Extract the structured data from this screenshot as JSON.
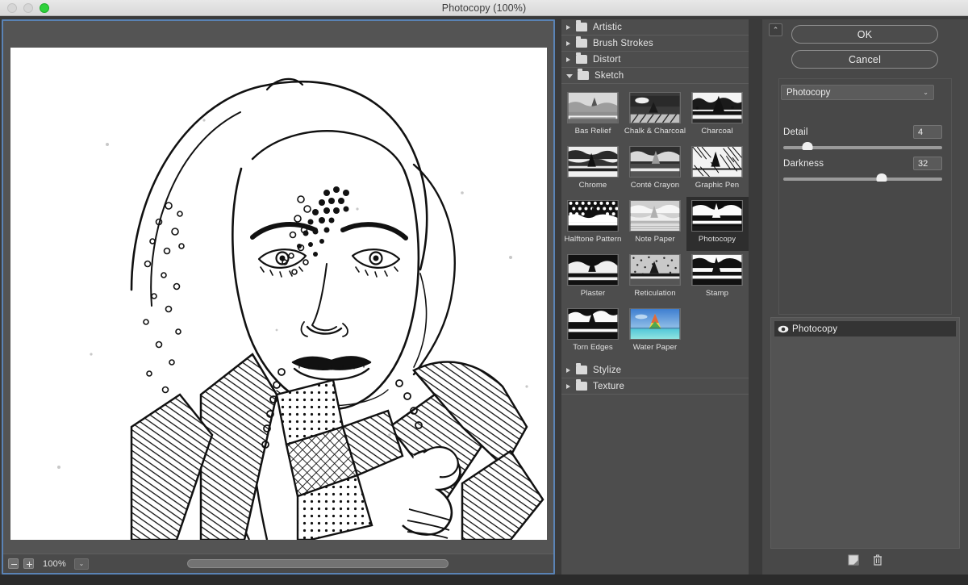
{
  "window": {
    "title": "Photocopy (100%)",
    "traffic_lights": [
      "close-button",
      "minimize-button",
      "maximize-button"
    ]
  },
  "preview": {
    "zoom_out_label": "−",
    "zoom_in_label": "+",
    "zoom_level": "100%",
    "zoom_chevron": "⌄",
    "image_description": "Photocopy-filtered black and white portrait of a woman wearing a fur hat and patterned knit scarf"
  },
  "filter_list": {
    "categories": [
      {
        "label": "Artistic",
        "expanded": false
      },
      {
        "label": "Brush Strokes",
        "expanded": false
      },
      {
        "label": "Distort",
        "expanded": false
      },
      {
        "label": "Sketch",
        "expanded": true
      },
      {
        "label": "Stylize",
        "expanded": false
      },
      {
        "label": "Texture",
        "expanded": false
      }
    ],
    "sketch_filters": [
      {
        "label": "Bas Relief",
        "selected": false
      },
      {
        "label": "Chalk & Charcoal",
        "selected": false
      },
      {
        "label": "Charcoal",
        "selected": false
      },
      {
        "label": "Chrome",
        "selected": false
      },
      {
        "label": "Conté Crayon",
        "selected": false
      },
      {
        "label": "Graphic Pen",
        "selected": false
      },
      {
        "label": "Halftone Pattern",
        "selected": false
      },
      {
        "label": "Note Paper",
        "selected": false
      },
      {
        "label": "Photocopy",
        "selected": true
      },
      {
        "label": "Plaster",
        "selected": false
      },
      {
        "label": "Reticulation",
        "selected": false
      },
      {
        "label": "Stamp",
        "selected": false
      },
      {
        "label": "Torn Edges",
        "selected": false
      },
      {
        "label": "Water Paper",
        "selected": false
      }
    ]
  },
  "options": {
    "collapse_icon": "⌃",
    "ok_label": "OK",
    "cancel_label": "Cancel",
    "filter_select_value": "Photocopy",
    "select_chevron": "⌄",
    "sliders": [
      {
        "label": "Detail",
        "value": "4",
        "percent": 15
      },
      {
        "label": "Darkness",
        "value": "32",
        "percent": 62
      }
    ]
  },
  "layers": {
    "items": [
      {
        "name": "Photocopy",
        "visible": true
      }
    ],
    "new_layer_label": "new-effect-layer",
    "delete_label": "delete-effect-layer"
  },
  "colors": {
    "panel_bg": "#484848",
    "filter_bg": "#4d4d4d",
    "preview_bg": "#545454",
    "focus_border": "#5a83b5",
    "selected_thumb": "#2e2e2e",
    "layer_selected": "#343434"
  }
}
